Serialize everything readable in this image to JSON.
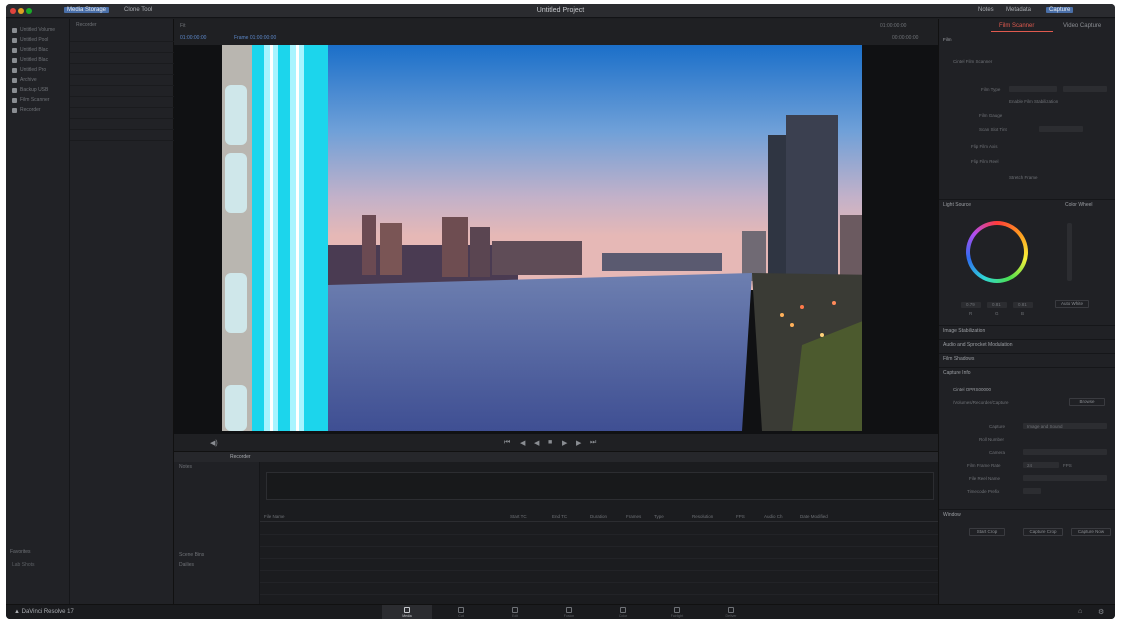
{
  "titlebar": {
    "title": "Untitled Project",
    "media_storage": "Media Storage",
    "clone_tool": "Clone Tool",
    "notes": "Notes",
    "metadata": "Metadata",
    "capture": "Capture"
  },
  "left": {
    "volumes": [
      "Untitled Volume",
      "Untitled Pool",
      "Untitled Blac",
      "Untitled Blac",
      "Untitled Pro",
      "Archive",
      "Backup USB",
      "Film Scanner",
      "Recorder"
    ],
    "file_header": "Recorder",
    "favorites_label": "Favorites",
    "favorite_item": "Lab Shots"
  },
  "viewer": {
    "fit": "Fit",
    "timecode_left": "01:00:00:00",
    "frame_label": "Frame 01:00:00:00",
    "timecode_right": "01:00:00:00",
    "duration": "00:00:00:00"
  },
  "transport": {
    "icons": [
      "⏮",
      "◀",
      "◀",
      "■",
      "▶",
      "▶",
      "⏭"
    ]
  },
  "bin": {
    "title": "Recorder",
    "notes_label": "Notes",
    "side_rows": [
      "Notes",
      "Scene Bins",
      "Dailies"
    ],
    "columns": [
      "File Name",
      "Start TC",
      "End TC",
      "Duration",
      "Frames",
      "Type",
      "Resolution",
      "FPS",
      "Audio Ch",
      "Date Modified"
    ]
  },
  "right": {
    "tabs": [
      "Film Scanner",
      "Video Capture"
    ],
    "film_label": "Film",
    "scanner_label": "Cintel Film Scanner",
    "rows": [
      "Film Type",
      "Enable Film Stabilization",
      "Film Gauge",
      "Scan Slot Tint",
      "Frame Size",
      "Flip Film Axis",
      "Flip Film Reel",
      "Stretch Frame"
    ],
    "light_source": "Light Source",
    "color_mode": "Color Wheel",
    "rgb": [
      "0.79",
      "0.81",
      "0.81"
    ],
    "rgb_labels": [
      "R",
      "G",
      "B"
    ],
    "auto_white": "Auto White",
    "sections": [
      "Image Stabilization",
      "Audio and Sprocket Modulation",
      "Film Shadows",
      "Capture Info"
    ],
    "capture_path": "Cintel OPRS00000",
    "capture_subpath": "/Volumes/Recorder/Capture",
    "browse": "Browse",
    "info_rows": [
      "Capture",
      "Roll Number",
      "Camera",
      "Film Frame Rate",
      "File Reel Name",
      "Timecode Prefix"
    ],
    "image_and_sound": "Image and Sound",
    "frame_rate": "24",
    "fps_unit": "FPS",
    "window_label": "Window",
    "buttons": [
      "Start Crop",
      "Capture Crop",
      "Capture Now"
    ]
  },
  "bottom": {
    "logo": "DaVinci Resolve 17",
    "pages": [
      "Media",
      "Cut",
      "Edit",
      "Fusion",
      "Color",
      "Fairlight",
      "Deliver"
    ]
  }
}
